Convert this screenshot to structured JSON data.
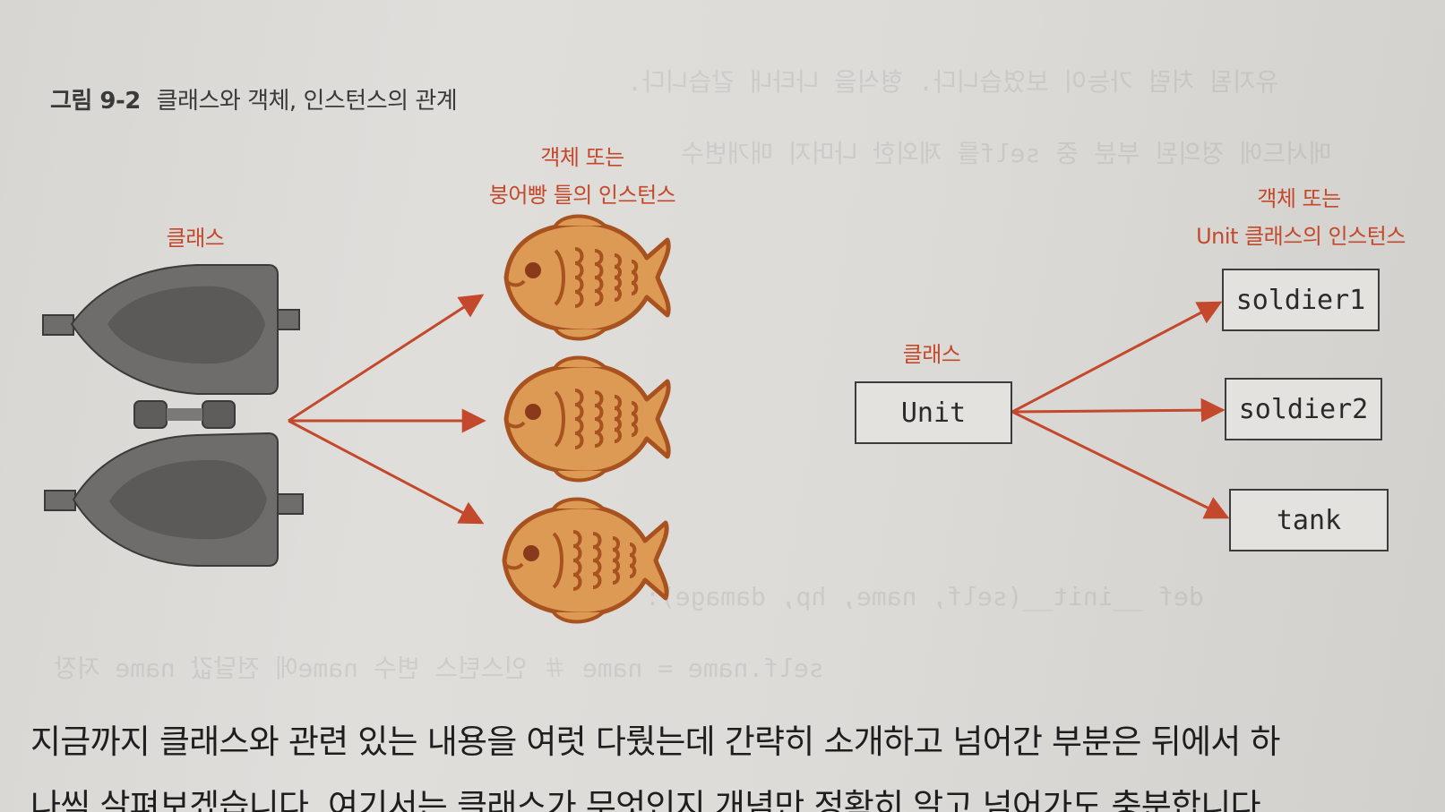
{
  "figure": {
    "caption_number": "그림 9-2",
    "caption_title": "클래스와 객체, 인스턴스의 관계"
  },
  "left_diagram": {
    "class_label": "클래스",
    "instance_label_line1": "객체 또는",
    "instance_label_line2": "붕어빵 틀의 인스턴스"
  },
  "right_diagram": {
    "class_label": "클래스",
    "class_name": "Unit",
    "instance_label_line1": "객체 또는",
    "instance_label_line2": "Unit 클래스의 인스턴스",
    "instances": [
      "soldier1",
      "soldier2",
      "tank"
    ]
  },
  "body": {
    "line1": "지금까지 클래스와 관련 있는 내용을 여럿 다뤘는데 간략히 소개하고 넘어간 부분은 뒤에서 하",
    "line2": "나씩 살펴보겠습니다. 여기서는 클래스가 무엇인지 개념만 정확히 알고 넘어가도 충분합니다."
  },
  "colors": {
    "accent": "#c4482c",
    "fish_fill": "#dc9a55",
    "fish_outline": "#a8521f",
    "mold_fill": "#6f6d6b"
  }
}
